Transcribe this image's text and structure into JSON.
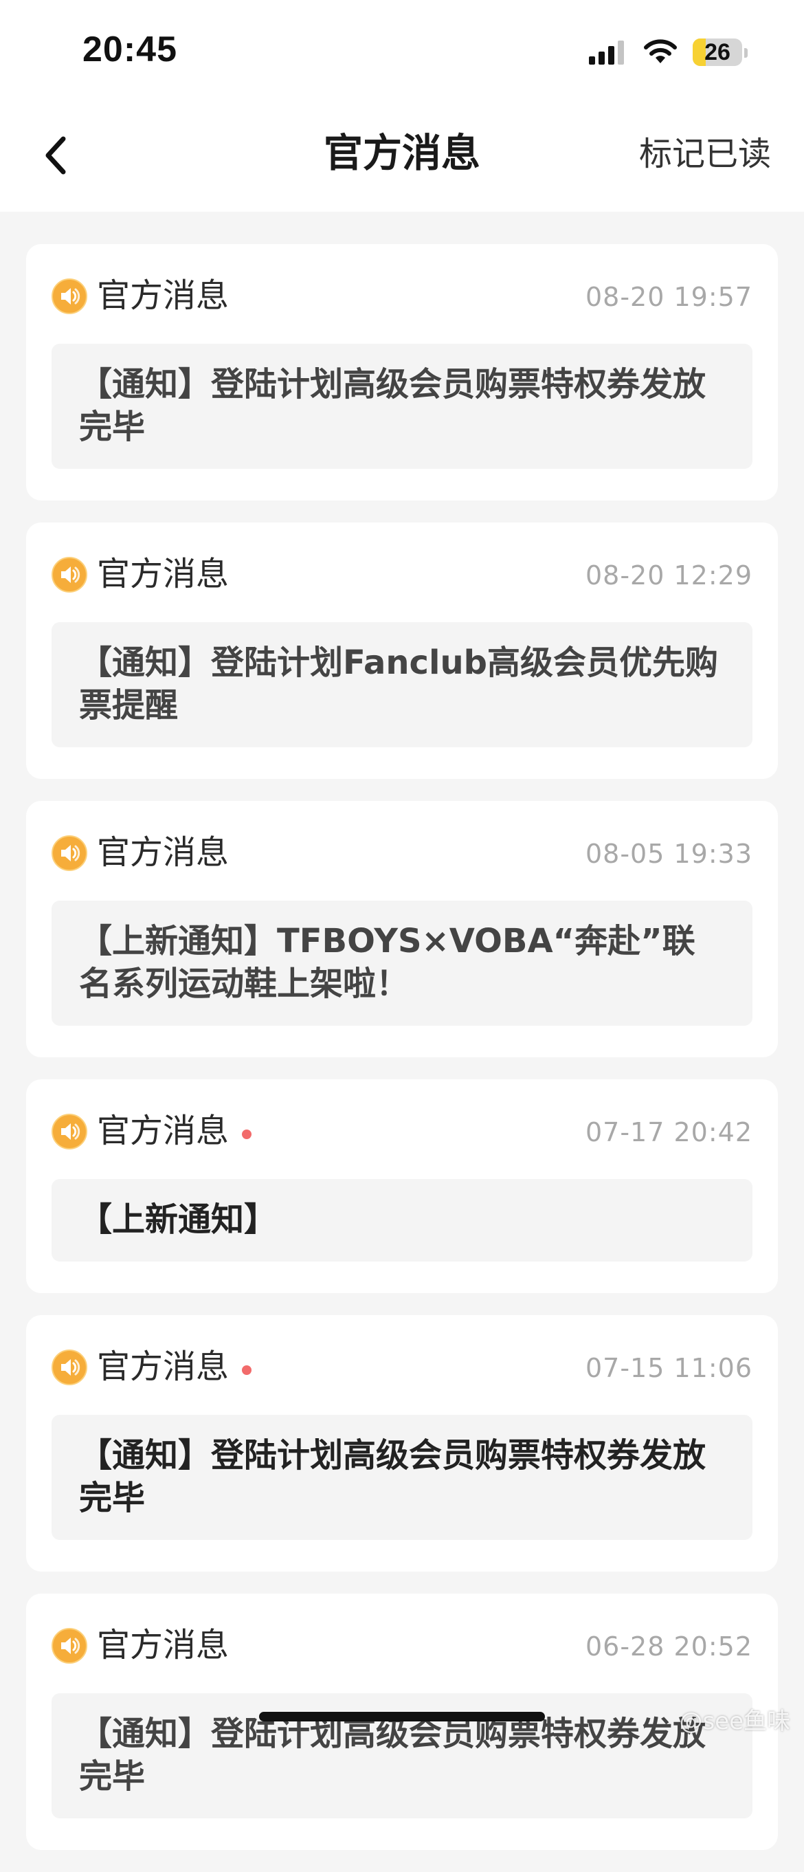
{
  "status_bar": {
    "time": "20:45",
    "battery": "26",
    "battery_level": 0.26
  },
  "nav": {
    "title": "官方消息",
    "mark_read": "标记已读"
  },
  "colors": {
    "icon_orange": "#f5a623",
    "unread_dot": "#f26b6b",
    "card_bg": "#ffffff",
    "body_bg": "#f4f4f4"
  },
  "messages": [
    {
      "sender": "官方消息",
      "time": "08-20 19:57",
      "body": "【通知】登陆计划高级会员购票特权券发放完毕",
      "unread": false
    },
    {
      "sender": "官方消息",
      "time": "08-20 12:29",
      "body": "【通知】登陆计划Fanclub高级会员优先购票提醒",
      "unread": false
    },
    {
      "sender": "官方消息",
      "time": "08-05 19:33",
      "body": "【上新通知】TFBOYS×VOBA“奔赴”联名系列运动鞋上架啦！",
      "unread": false
    },
    {
      "sender": "官方消息",
      "time": "07-17 20:42",
      "body": "【上新通知】",
      "unread": true
    },
    {
      "sender": "官方消息",
      "time": "07-15 11:06",
      "body": "【通知】登陆计划高级会员购票特权券发放完毕",
      "unread": true
    },
    {
      "sender": "官方消息",
      "time": "06-28 20:52",
      "body": "【通知】登陆计划高级会员购票特权券发放完毕",
      "unread": false
    }
  ],
  "watermark": "@see鱼味"
}
